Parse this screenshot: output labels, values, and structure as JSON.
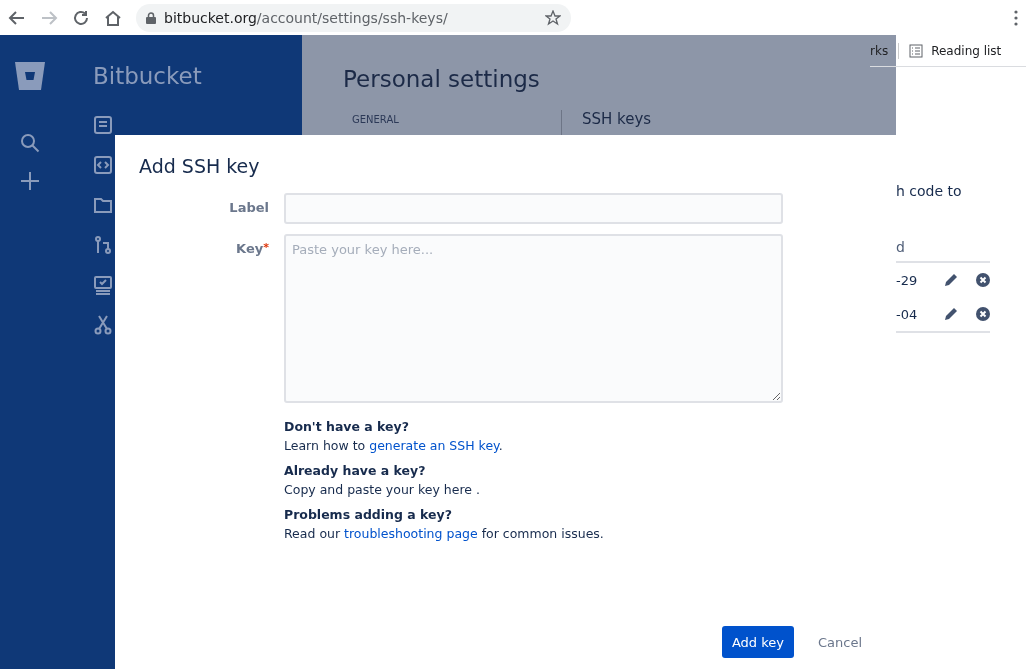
{
  "browser": {
    "url_host": "bitbucket.org",
    "url_path": "/account/settings/ssh-keys/",
    "bookmarks": [
      "rks",
      "Reading list"
    ]
  },
  "sidebar": {
    "product": "Bitbucket"
  },
  "page": {
    "title": "Personal settings",
    "nav_heading": "GENERAL",
    "section_title": "SSH keys",
    "intro_fragment": "h code to",
    "table_header_fragment": "d",
    "rows": [
      {
        "date_fragment": "-29"
      },
      {
        "date_fragment": "-04"
      }
    ]
  },
  "dialog": {
    "title": "Add SSH key",
    "fields": [
      {
        "kind": "input",
        "label": "Label"
      },
      {
        "kind": "textarea",
        "label": "Key",
        "required_mark": "*",
        "placeholder": "Paste your key here..."
      }
    ],
    "help": [
      {
        "heading": "Don't have a key?",
        "before": "Learn how to ",
        "link": "generate an SSH key",
        "after": "."
      },
      {
        "heading": "Already have a key?",
        "before": "Copy and paste your key here ."
      },
      {
        "heading": "Problems adding a key?",
        "before": "Read our ",
        "link": "troubleshooting page",
        "after": " for common issues."
      }
    ],
    "primary_button": "Add key",
    "cancel_link": "Cancel"
  }
}
